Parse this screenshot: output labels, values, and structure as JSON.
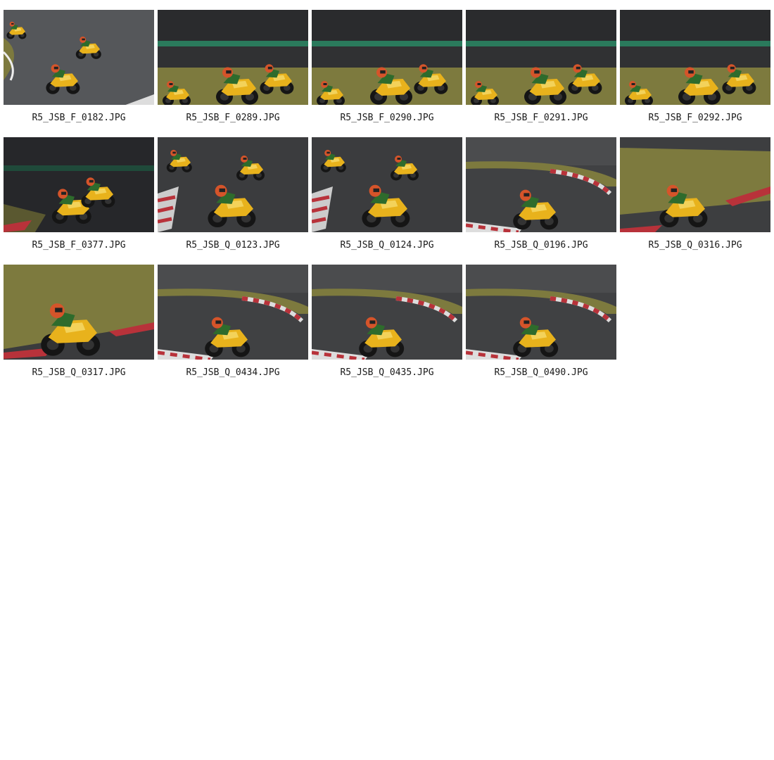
{
  "gallery": {
    "rows": [
      [
        {
          "caption": "R5_JSB_F_0182.JPG",
          "scene": "asphalt-wide"
        },
        {
          "caption": "R5_JSB_F_0289.JPG",
          "scene": "grass-pack"
        },
        {
          "caption": "R5_JSB_F_0290.JPG",
          "scene": "grass-pack"
        },
        {
          "caption": "R5_JSB_F_0291.JPG",
          "scene": "grass-pack"
        },
        {
          "caption": "R5_JSB_F_0292.JPG",
          "scene": "grass-pack"
        }
      ],
      [
        {
          "caption": "R5_JSB_F_0377.JPG",
          "scene": "shadow-pack"
        },
        {
          "caption": "R5_JSB_Q_0123.JPG",
          "scene": "asphalt-lean"
        },
        {
          "caption": "R5_JSB_Q_0124.JPG",
          "scene": "asphalt-lean"
        },
        {
          "caption": "R5_JSB_Q_0196.JPG",
          "scene": "curb-lean"
        },
        {
          "caption": "R5_JSB_Q_0316.JPG",
          "scene": "grass-lean"
        }
      ],
      [
        {
          "caption": "R5_JSB_Q_0317.JPG",
          "scene": "grass-close"
        },
        {
          "caption": "R5_JSB_Q_0434.JPG",
          "scene": "curb-lean"
        },
        {
          "caption": "R5_JSB_Q_0435.JPG",
          "scene": "curb-lean"
        },
        {
          "caption": "R5_JSB_Q_0490.JPG",
          "scene": "curb-lean"
        }
      ]
    ]
  },
  "colors": {
    "asphalt": "#3a3b3d",
    "grass": "#7d7a3e",
    "bike_yellow": "#e8b21c",
    "helmet": "#d5542a",
    "curb_red": "#b8323a"
  }
}
